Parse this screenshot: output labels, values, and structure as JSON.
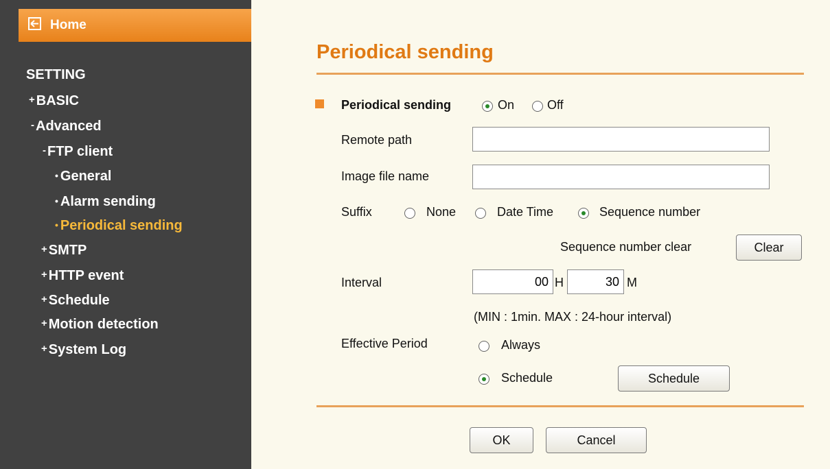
{
  "sidebar": {
    "home_label": "Home",
    "setting_label": "SETTING",
    "items": [
      {
        "prefix": "+",
        "label": "BASIC"
      },
      {
        "prefix": "-",
        "label": "Advanced"
      },
      {
        "prefix": "-",
        "label": "FTP client"
      },
      {
        "prefix": "•",
        "label": "General"
      },
      {
        "prefix": "•",
        "label": "Alarm sending"
      },
      {
        "prefix": "•",
        "label": "Periodical sending"
      },
      {
        "prefix": "+",
        "label": "SMTP"
      },
      {
        "prefix": "+",
        "label": "HTTP event"
      },
      {
        "prefix": "+",
        "label": "Schedule"
      },
      {
        "prefix": "+",
        "label": "Motion detection"
      },
      {
        "prefix": "+",
        "label": "System Log"
      }
    ]
  },
  "main": {
    "title": "Periodical sending",
    "periodical": {
      "label": "Periodical sending",
      "on": "On",
      "off": "Off",
      "selected": "On"
    },
    "remote_path": {
      "label": "Remote path",
      "value": ""
    },
    "image_file_name": {
      "label": "Image file name",
      "value": ""
    },
    "suffix": {
      "label": "Suffix",
      "none": "None",
      "date_time": "Date Time",
      "sequence": "Sequence number",
      "selected": "Sequence number"
    },
    "seq_clear": {
      "label": "Sequence number clear",
      "button": "Clear"
    },
    "interval": {
      "label": "Interval",
      "hours": "00",
      "h_unit": "H",
      "minutes": "30",
      "m_unit": "M",
      "note": "(MIN : 1min. MAX : 24-hour interval)"
    },
    "effective": {
      "label": "Effective Period",
      "always": "Always",
      "schedule": "Schedule",
      "schedule_button": "Schedule",
      "selected": "Schedule"
    },
    "ok": "OK",
    "cancel": "Cancel"
  },
  "colors": {
    "sidebar_bg": "#414141",
    "accent": "#e07a14",
    "active_nav": "#f7b93a",
    "page_bg": "#fbf9ec"
  }
}
